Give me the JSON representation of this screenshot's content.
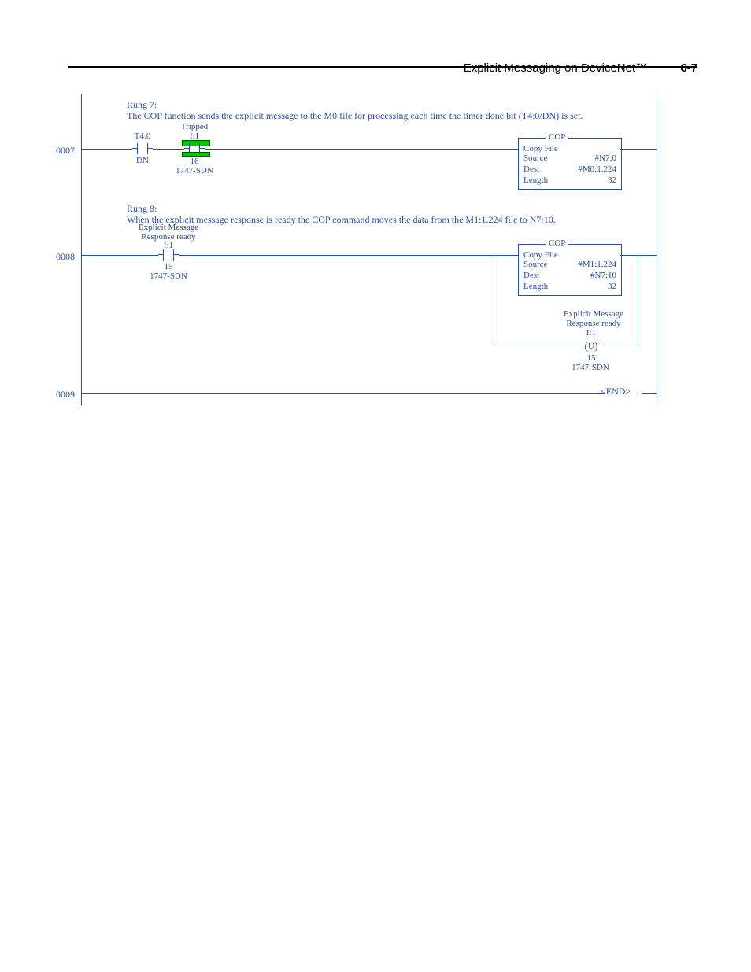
{
  "header": {
    "title": "Explicit Messaging on DeviceNet™",
    "page_number": "6-7"
  },
  "rung7": {
    "number": "0007",
    "comment_title": "Rung 7:",
    "comment_text": "The COP function sends the explicit message to the M0 file for processing each time the timer done bit (T4:0/DN) is set.",
    "xic1": {
      "address": "T4:0",
      "bit_label_below": "DN"
    },
    "xic2": {
      "top_line": "Tripped",
      "address": "I:1",
      "bit": "16",
      "module": "1747-SDN"
    },
    "cop": {
      "title": "COP",
      "subtitle": "Copy File",
      "source_label": "Source",
      "source_value": "#N7:0",
      "dest_label": "Dest",
      "dest_value": "#M0:1.224",
      "length_label": "Length",
      "length_value": "32"
    }
  },
  "rung8": {
    "number": "0008",
    "comment_title": "Rung 8:",
    "comment_text": "When the explicit message response is ready the COP command moves the data from the M1:1.224 file to N7:10.",
    "xic": {
      "top_line1": "Explicit Message",
      "top_line2": "Response ready",
      "address": "I:1",
      "bit": "15",
      "module": "1747-SDN"
    },
    "cop": {
      "title": "COP",
      "subtitle": "Copy File",
      "source_label": "Source",
      "source_value": "#M1:1.224",
      "dest_label": "Dest",
      "dest_value": "#N7:10",
      "length_label": "Length",
      "length_value": "32"
    },
    "otu": {
      "top_line1": "Explicit Message",
      "top_line2": "Response ready",
      "address": "I:1",
      "symbol_letter": "U",
      "bit": "15",
      "module": "1747-SDN"
    }
  },
  "rung9": {
    "number": "0009",
    "end_label": "END"
  }
}
